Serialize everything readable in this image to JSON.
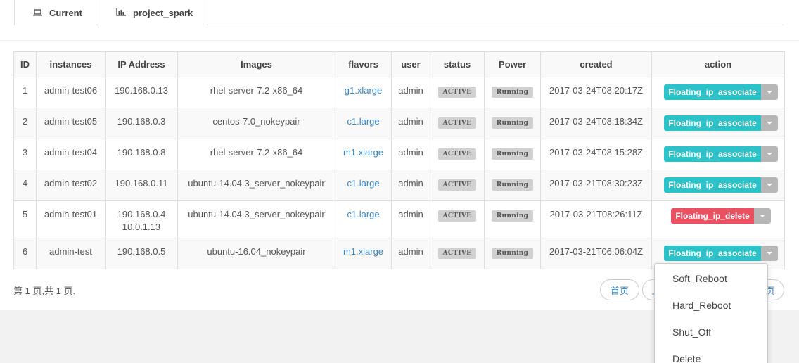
{
  "tabs": [
    {
      "label": "Current",
      "icon": "laptop-icon"
    },
    {
      "label": "project_spark",
      "icon": "bar-chart-icon"
    }
  ],
  "table": {
    "headers": [
      "ID",
      "instances",
      "IP Address",
      "Images",
      "flavors",
      "user",
      "status",
      "Power",
      "created",
      "action"
    ],
    "rows": [
      {
        "id": "1",
        "instance": "admin-test06",
        "ip": "190.168.0.13",
        "ip2": "",
        "image": "rhel-server-7.2-x86_64",
        "flavor": "g1.xlarge",
        "user": "admin",
        "status": "ACTIVE",
        "power": "Running",
        "created": "2017-03-24T08:20:17Z",
        "action": "Floating_ip_associate",
        "action_color": "#2bc3c9"
      },
      {
        "id": "2",
        "instance": "admin-test05",
        "ip": "190.168.0.3",
        "ip2": "",
        "image": "centos-7.0_nokeypair",
        "flavor": "c1.large",
        "user": "admin",
        "status": "ACTIVE",
        "power": "Running",
        "created": "2017-03-24T08:18:34Z",
        "action": "Floating_ip_associate",
        "action_color": "#2bc3c9"
      },
      {
        "id": "3",
        "instance": "admin-test04",
        "ip": "190.168.0.8",
        "ip2": "",
        "image": "rhel-server-7.2-x86_64",
        "flavor": "m1.xlarge",
        "user": "admin",
        "status": "ACTIVE",
        "power": "Running",
        "created": "2017-03-24T08:15:28Z",
        "action": "Floating_ip_associate",
        "action_color": "#2bc3c9"
      },
      {
        "id": "4",
        "instance": "admin-test02",
        "ip": "190.168.0.11",
        "ip2": "",
        "image": "ubuntu-14.04.3_server_nokeypair",
        "flavor": "c1.large",
        "user": "admin",
        "status": "ACTIVE",
        "power": "Running",
        "created": "2017-03-21T08:30:23Z",
        "action": "Floating_ip_associate",
        "action_color": "#2bc3c9"
      },
      {
        "id": "5",
        "instance": "admin-test01",
        "ip": "190.168.0.4",
        "ip2": "10.0.1.13",
        "image": "ubuntu-14.04.3_server_nokeypair",
        "flavor": "c1.large",
        "user": "admin",
        "status": "ACTIVE",
        "power": "Running",
        "created": "2017-03-21T08:26:11Z",
        "action": "Floating_ip_delete",
        "action_color": "#eb5060"
      },
      {
        "id": "6",
        "instance": "admin-test",
        "ip": "190.168.0.5",
        "ip2": "",
        "image": "ubuntu-16.04_nokeypair",
        "flavor": "m1.xlarge",
        "user": "admin",
        "status": "ACTIVE",
        "power": "Running",
        "created": "2017-03-21T06:06:04Z",
        "action": "Floating_ip_associate",
        "action_color": "#2bc3c9"
      }
    ]
  },
  "pager": {
    "info": "第 1 页,共 1 页.",
    "first": "首页",
    "prev": "上",
    "last": "页"
  },
  "dropdown": {
    "items": [
      "Soft_Reboot",
      "Hard_Reboot",
      "Shut_Off",
      "Delete"
    ]
  }
}
